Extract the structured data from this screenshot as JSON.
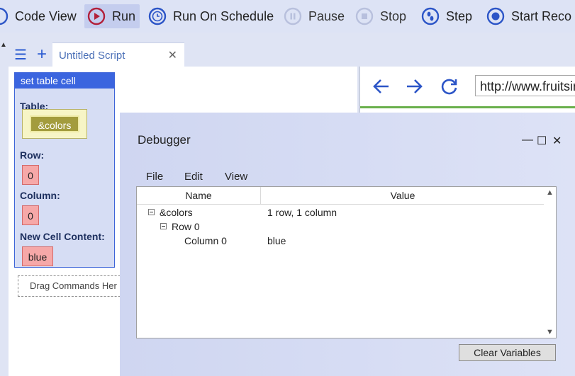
{
  "toolbar": {
    "code_view": "Code View",
    "run": "Run",
    "run_on_schedule": "Run On Schedule",
    "pause": "Pause",
    "stop": "Stop",
    "step": "Step",
    "start_recording": "Start Reco"
  },
  "tabs": {
    "script_tab": "Untitled Script",
    "close_glyph": "✕",
    "menu_glyph": "☰",
    "add_glyph": "+"
  },
  "command_block": {
    "title": "set table cell",
    "table_label": "Table:",
    "table_value": "&colors",
    "row_label": "Row:",
    "row_value": "0",
    "column_label": "Column:",
    "column_value": "0",
    "content_label": "New Cell Content:",
    "content_value": "blue"
  },
  "drag_target": "Drag Commands Her",
  "browser": {
    "url": "http://www.fruitsir"
  },
  "debugger": {
    "title": "Debugger",
    "menu": {
      "file": "File",
      "edit": "Edit",
      "view": "View"
    },
    "columns": {
      "name": "Name",
      "value": "Value"
    },
    "rows": [
      {
        "name": "&colors",
        "value": "1 row, 1 column",
        "level": 0,
        "expandable": true
      },
      {
        "name": "Row 0",
        "value": "",
        "level": 1,
        "expandable": true
      },
      {
        "name": "Column 0",
        "value": "blue",
        "level": 2,
        "expandable": false
      }
    ],
    "clear_button": "Clear Variables"
  },
  "colors": {
    "accent_blue": "#3b65df",
    "run_red": "#b2203a",
    "toolbar_icon_blue": "#2c55c7",
    "disabled_icon": "#b8c0dd"
  },
  "icons": {
    "code_view": "code-view-icon",
    "run": "play-icon",
    "run_on_schedule": "clock-icon",
    "pause": "pause-icon",
    "stop": "stop-icon",
    "step": "footstep-icon",
    "record": "record-icon"
  }
}
